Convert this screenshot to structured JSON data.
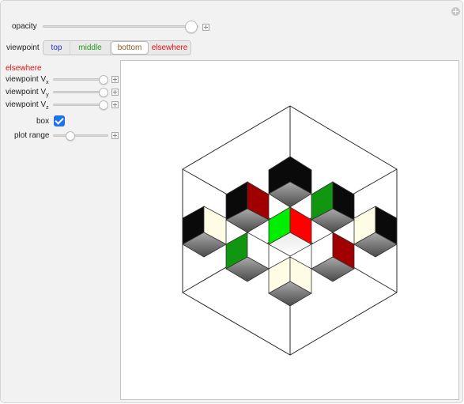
{
  "controls": {
    "opacity_label": "opacity",
    "opacity_value": 0.9,
    "viewpoint_label": "viewpoint",
    "viewpoint_options": [
      {
        "label": "top",
        "color": "#1a2fd6"
      },
      {
        "label": "middle",
        "color": "#1f9a1f"
      },
      {
        "label": "bottom",
        "color": "#8a5a1e"
      },
      {
        "label": "elsewhere",
        "color": "#e01010"
      }
    ],
    "viewpoint_selected": "bottom",
    "section_title": "elsewhere",
    "section_title_color": "#e01010",
    "vx_label": "viewpoint V",
    "vx_sub": "x",
    "vx_value": 1.0,
    "vy_label": "viewpoint V",
    "vy_sub": "y",
    "vy_value": 1.0,
    "vz_label": "viewpoint V",
    "vz_sub": "z",
    "vz_value": 1.0,
    "box_label": "box",
    "box_checked": true,
    "plot_range_label": "plot range",
    "plot_range_value": 0.3
  },
  "colors": {
    "cube_black": "#0a0a0a",
    "cube_red": "#ff0000",
    "cube_darkred": "#a00000",
    "cube_green": "#00ee00",
    "cube_darkgreen": "#119611",
    "cube_cream": "#fffce6",
    "cube_gray": "#777777"
  }
}
